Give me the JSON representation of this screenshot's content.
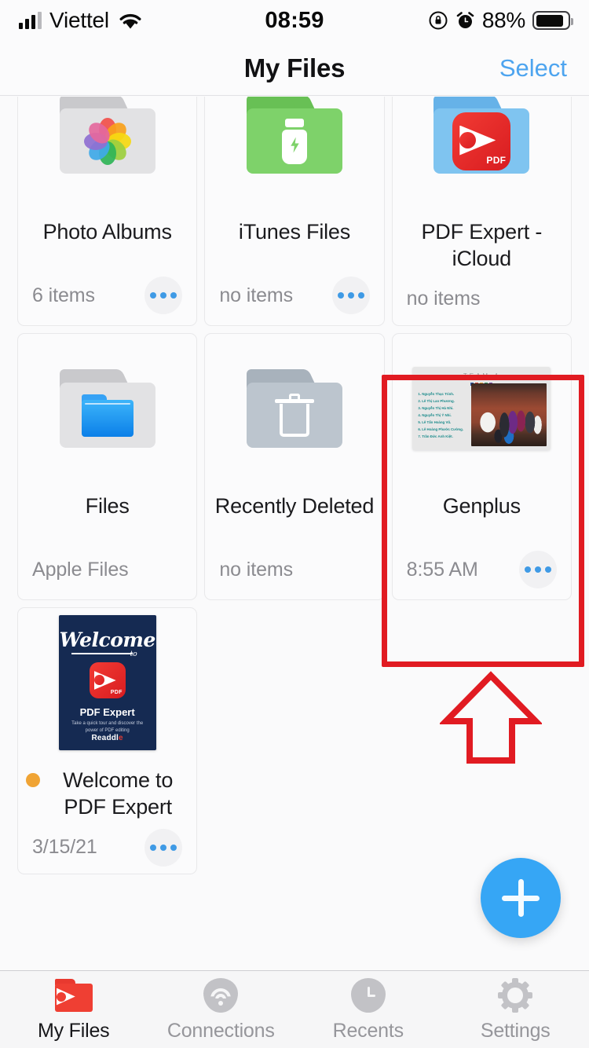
{
  "status_bar": {
    "carrier": "Viettel",
    "wifi_icon": "wifi-icon",
    "signal_icon": "cellular-signal-icon",
    "time": "08:59",
    "rotation_lock_icon": "rotation-lock-icon",
    "alarm_icon": "alarm-clock-icon",
    "battery_percent": "88%",
    "battery_icon": "battery-icon"
  },
  "header": {
    "title": "My Files",
    "select_label": "Select"
  },
  "colors": {
    "accent_blue": "#36a6f5",
    "link_blue": "#4da4ef",
    "annotation_red": "#e11b22",
    "unread_orange": "#f0a435",
    "brand_red": "#ef3f33"
  },
  "grid": {
    "items": [
      {
        "name": "Photo Albums",
        "subtitle": "6 items",
        "icon": "photos-folder-icon",
        "folder_color": "gray",
        "has_more_button": true,
        "unread": false,
        "highlighted": false
      },
      {
        "name": "iTunes Files",
        "subtitle": "no items",
        "icon": "itunes-usb-folder-icon",
        "folder_color": "green",
        "has_more_button": true,
        "unread": false,
        "highlighted": false
      },
      {
        "name": "PDF Expert - iCloud",
        "subtitle": "no items",
        "icon": "pdf-expert-icloud-folder-icon",
        "folder_color": "blue",
        "has_more_button": false,
        "unread": false,
        "highlighted": false
      },
      {
        "name": "Files",
        "subtitle": "Apple Files",
        "icon": "apple-files-folder-icon",
        "folder_color": "gray",
        "has_more_button": false,
        "unread": false,
        "highlighted": false
      },
      {
        "name": "Recently Deleted",
        "subtitle": "no items",
        "icon": "trash-folder-icon",
        "folder_color": "slate",
        "has_more_button": false,
        "unread": false,
        "highlighted": false
      },
      {
        "name": "Genplus",
        "subtitle": "8:55 AM",
        "icon": "presentation-slide-thumbnail",
        "has_more_button": true,
        "unread": false,
        "highlighted": true
      },
      {
        "name": "Welcome to PDF Expert",
        "subtitle": "3/15/21",
        "icon": "pdf-cover-thumbnail",
        "has_more_button": true,
        "unread": true,
        "highlighted": false
      }
    ]
  },
  "genplus_thumbnail": {
    "heading": "TEAM 4",
    "names": [
      "1. Nguyễn Thục Trinh.",
      "2. Lê Thị Lan Phương.",
      "3. Nguyễn Thị Hà Nhi.",
      "4. Nguyễn Thị Ý Nhi.",
      "5. Lê Tấn Hoàng Vũ.",
      "6. Lê Hoàng Phước Cường.",
      "7. Trần Đức Anh Kiệt."
    ],
    "photo_alt": "group-photo-traditional-dress"
  },
  "welcome_cover": {
    "welcome": "Welcome",
    "to": "to",
    "product": "PDF Expert",
    "tagline": "Take a quick tour and discover the power of PDF editing",
    "brand": "Readdle"
  },
  "fab": {
    "label": "add-button",
    "icon": "plus-icon"
  },
  "annotations": {
    "highlight_box": "red-rectangle-around-genplus",
    "arrow": "red-up-arrow-pointing-to-genplus"
  },
  "tab_bar": {
    "tabs": [
      {
        "label": "My Files",
        "icon": "pdf-expert-folder-icon",
        "active": true
      },
      {
        "label": "Connections",
        "icon": "wifi-icon",
        "active": false
      },
      {
        "label": "Recents",
        "icon": "clock-icon",
        "active": false
      },
      {
        "label": "Settings",
        "icon": "gear-icon",
        "active": false
      }
    ]
  }
}
